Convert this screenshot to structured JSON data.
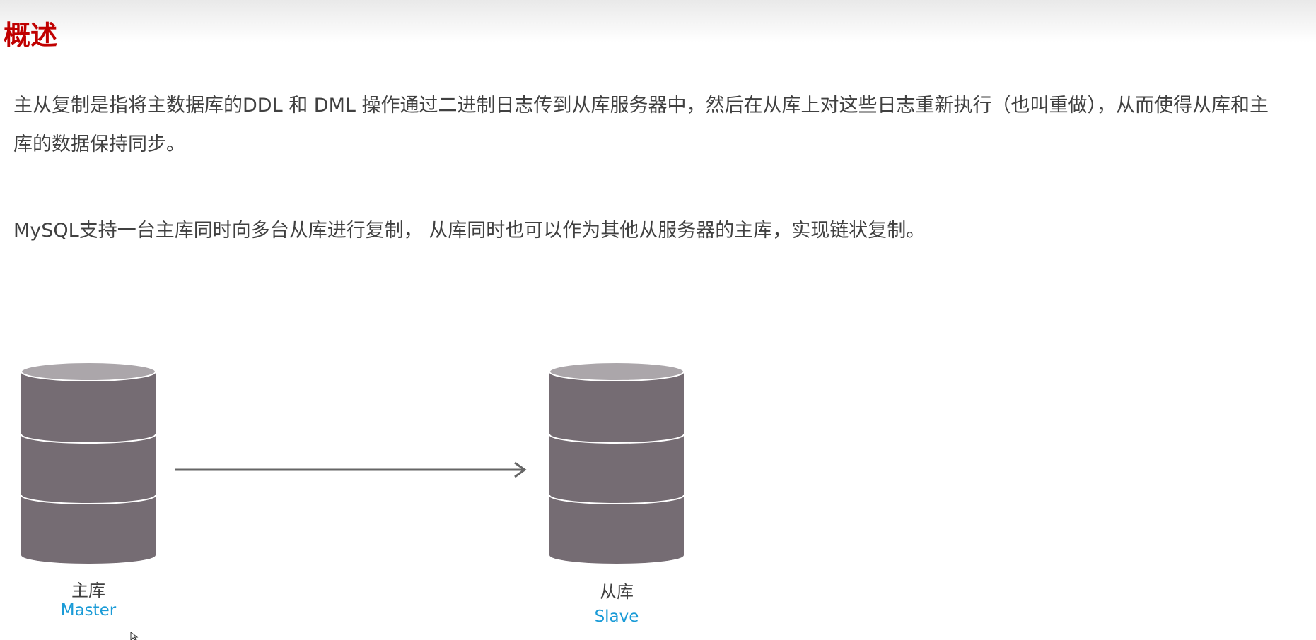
{
  "slide": {
    "title": "概述",
    "paragraph1": "主从复制是指将主数据库的DDL 和 DML 操作通过二进制日志传到从库服务器中，然后在从库上对这些日志重新执行（也叫重做），从而使得从库和主库的数据保持同步。",
    "paragraph2": "MySQL支持一台主库同时向多台从库进行复制， 从库同时也可以作为其他从服务器的主库，实现链状复制。"
  },
  "diagram": {
    "master": {
      "label": "主库",
      "sublabel": "Master"
    },
    "slave": {
      "label": "从库",
      "sublabel": "Slave"
    }
  },
  "colors": {
    "title": "#c00000",
    "body_text": "#404040",
    "cylinder_body": "#756c73",
    "cylinder_top": "#aba6aa",
    "sublabel": "#1a9bd7",
    "arrow": "#666666"
  },
  "icons": {
    "master_db": "database-cylinder-icon",
    "slave_db": "database-cylinder-icon",
    "arrow": "arrow-right-icon",
    "cursor": "mouse-cursor-icon"
  }
}
